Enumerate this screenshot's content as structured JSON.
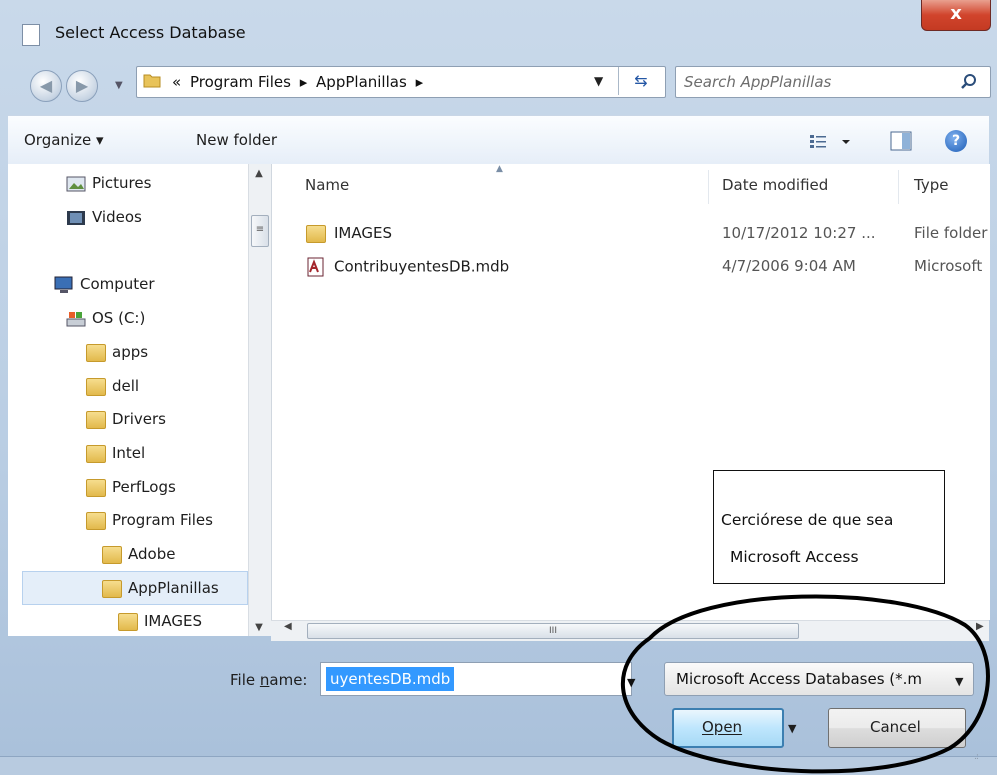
{
  "window": {
    "title": "Select Access Database",
    "close_label": "x"
  },
  "address": {
    "crumbs": [
      "«",
      "Program Files",
      "▸",
      "AppPlanillas",
      "▸"
    ],
    "search_placeholder": "Search AppPlanillas"
  },
  "toolbar": {
    "organize_label": "Organize ▾",
    "new_folder_label": "New folder",
    "help_label": "?"
  },
  "nav_pane": {
    "items": [
      {
        "label": "Pictures"
      },
      {
        "label": "Videos"
      },
      {
        "label": "Computer"
      },
      {
        "label": "OS (C:)"
      },
      {
        "label": "apps"
      },
      {
        "label": "dell"
      },
      {
        "label": "Drivers"
      },
      {
        "label": "Intel"
      },
      {
        "label": "PerfLogs"
      },
      {
        "label": "Program Files"
      },
      {
        "label": "Adobe"
      },
      {
        "label": "AppPlanillas"
      },
      {
        "label": "IMAGES"
      }
    ],
    "selected": "AppPlanillas"
  },
  "file_list": {
    "columns": [
      "Name",
      "Date modified",
      "Type"
    ],
    "rows": [
      {
        "name": "IMAGES",
        "date": "10/17/2012 10:27 ...",
        "type": "File folder",
        "icon": "folder-icon"
      },
      {
        "name": "ContribuyentesDB.mdb",
        "date": "4/7/2006 9:04 AM",
        "type": "Microsoft",
        "icon": "access-db-icon"
      }
    ]
  },
  "annotation": {
    "line1": "Cerciórese de que sea",
    "line2": "Microsoft Access"
  },
  "hscroll_label": "III",
  "bottom": {
    "file_name_label_pre": "File ",
    "file_name_label_u": "n",
    "file_name_label_post": "ame:",
    "file_name_value": "uyentesDB.mdb",
    "file_type_value": "Microsoft Access Databases (*.m",
    "open_label": "Open",
    "cancel_label": "Cancel"
  }
}
